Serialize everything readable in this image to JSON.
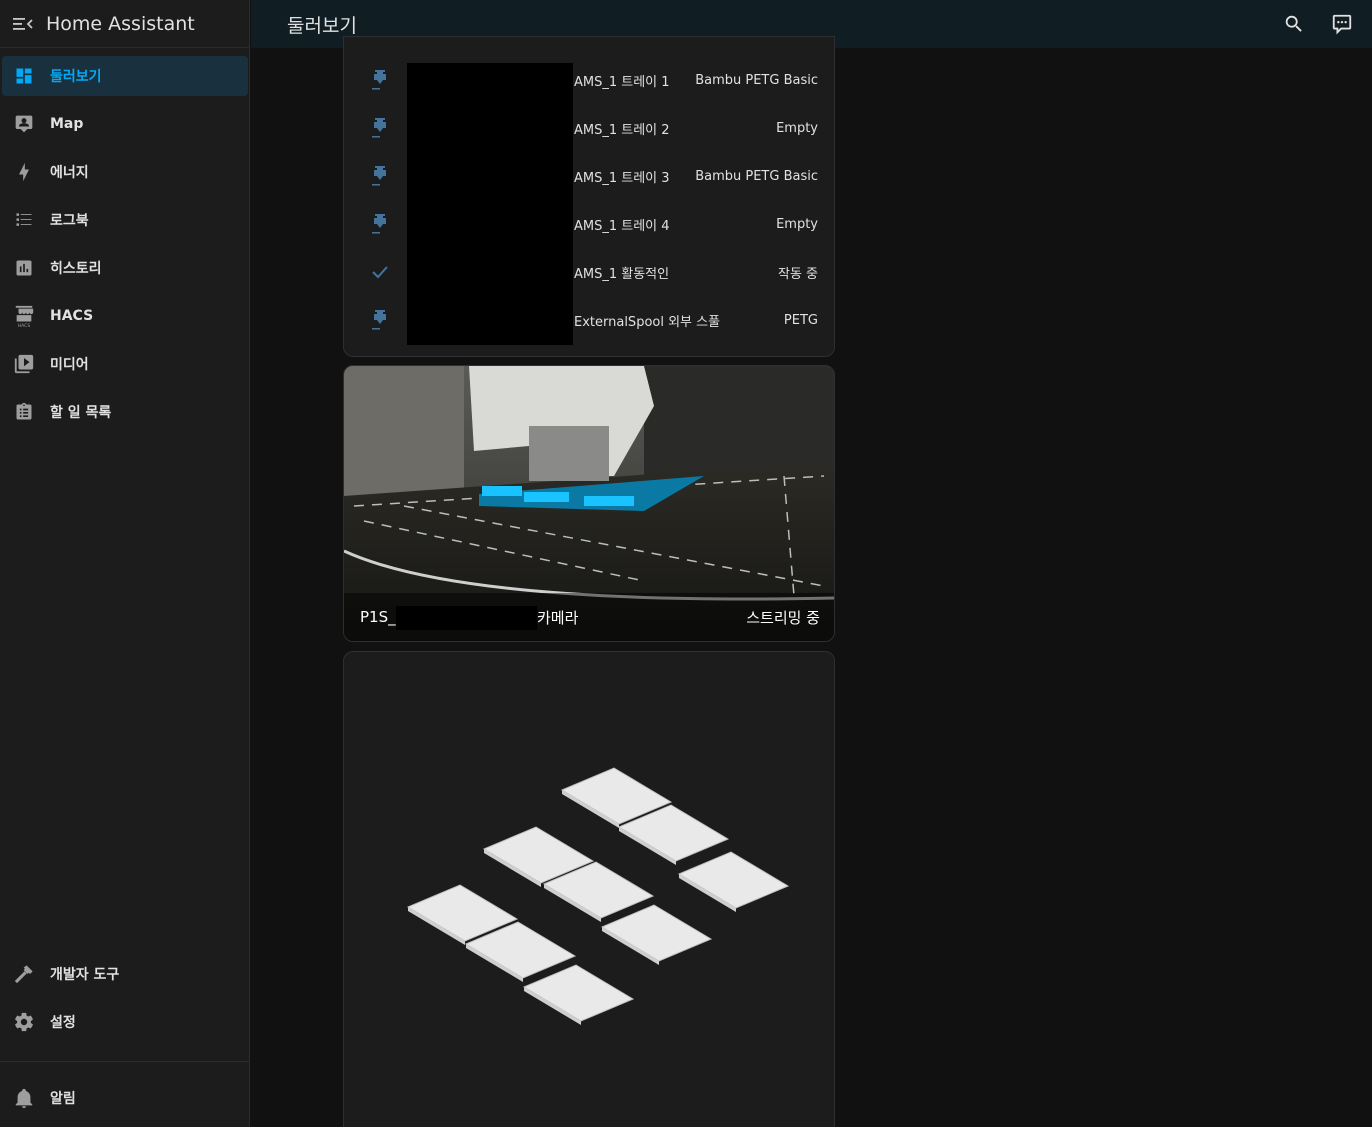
{
  "app": {
    "title": "Home Assistant"
  },
  "header": {
    "title": "둘러보기"
  },
  "sidebar": {
    "items": [
      {
        "label": "둘러보기",
        "icon": "dashboard-icon",
        "active": true
      },
      {
        "label": "Map",
        "icon": "map-icon"
      },
      {
        "label": "에너지",
        "icon": "lightning-bolt-icon"
      },
      {
        "label": "로그북",
        "icon": "logbook-icon"
      },
      {
        "label": "히스토리",
        "icon": "history-chart-icon"
      },
      {
        "label": "HACS",
        "icon": "hacs-store-icon"
      },
      {
        "label": "미디어",
        "icon": "media-play-icon"
      },
      {
        "label": "할 일 목록",
        "icon": "todo-clipboard-icon"
      }
    ],
    "bottom_items": [
      {
        "label": "개발자 도구",
        "icon": "hammer-icon"
      },
      {
        "label": "설정",
        "icon": "gear-icon"
      }
    ],
    "notifications": {
      "label": "알림",
      "icon": "bell-icon"
    }
  },
  "entities": [
    {
      "name": "AMS_1 트레이 1",
      "state": "Bambu PETG Basic",
      "icon": "printer-3d-nozzle-icon"
    },
    {
      "name": "AMS_1 트레이 2",
      "state": "Empty",
      "icon": "printer-3d-nozzle-icon"
    },
    {
      "name": "AMS_1 트레이 3",
      "state": "Bambu PETG Basic",
      "icon": "printer-3d-nozzle-icon"
    },
    {
      "name": "AMS_1 트레이 4",
      "state": "Empty",
      "icon": "printer-3d-nozzle-icon"
    },
    {
      "name": "AMS_1 활동적인",
      "state": "작동 중",
      "icon": "check-icon"
    },
    {
      "name": "ExternalSpool 외부 스풀",
      "state": "PETG",
      "icon": "printer-3d-nozzle-icon"
    }
  ],
  "camera": {
    "name_prefix": "P1S_",
    "name_suffix": "카메라",
    "state": "스트리밍 중"
  },
  "colors": {
    "accent": "#03a9f4",
    "icon_blue": "#44739e",
    "sidebar_bg": "#1c1c1c",
    "topbar_bg": "#101e24",
    "card_bg": "#1c1c1c",
    "page_bg": "#111111"
  }
}
